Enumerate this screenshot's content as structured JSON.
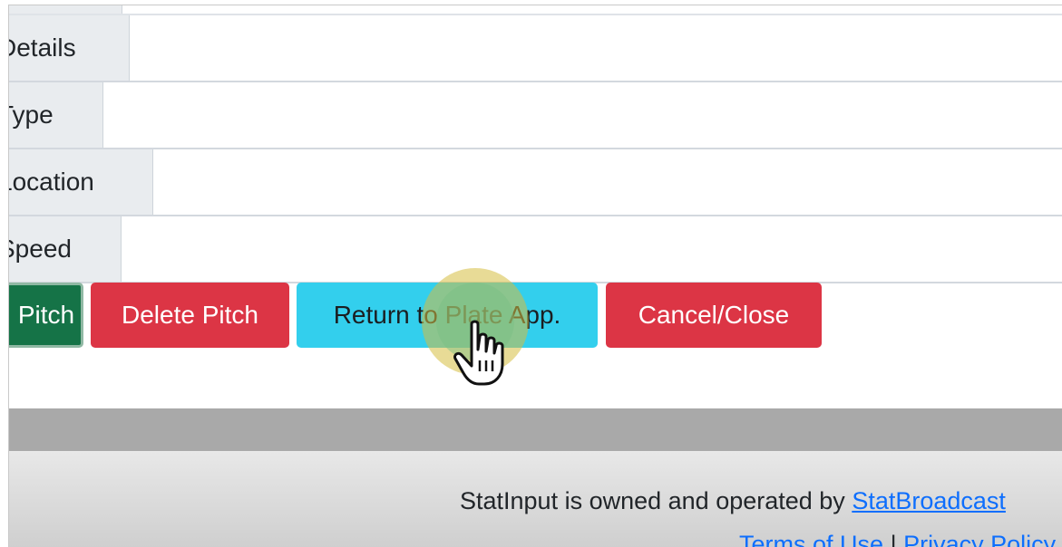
{
  "form": {
    "rows": [
      {
        "label": "Details",
        "value": ""
      },
      {
        "label": "Type",
        "value": ""
      },
      {
        "label": "Location",
        "value": ""
      },
      {
        "label": "Speed",
        "value": ""
      }
    ]
  },
  "buttons": {
    "save_label": "Pitch",
    "delete_label": "Delete Pitch",
    "return_label": "Return to Plate App.",
    "cancel_label": "Cancel/Close"
  },
  "footer": {
    "owned_text": "StatInput is owned and operated by ",
    "owner_link": "StatBroadcast",
    "terms_link": "Terms of Use",
    "separator": "|",
    "privacy_link": "Privacy Policy"
  },
  "colors": {
    "success": "#157347",
    "danger": "#dc3545",
    "info": "#33cfed",
    "link": "#0d6efd"
  },
  "icons": {
    "cursor": "hand-pointer-icon"
  }
}
